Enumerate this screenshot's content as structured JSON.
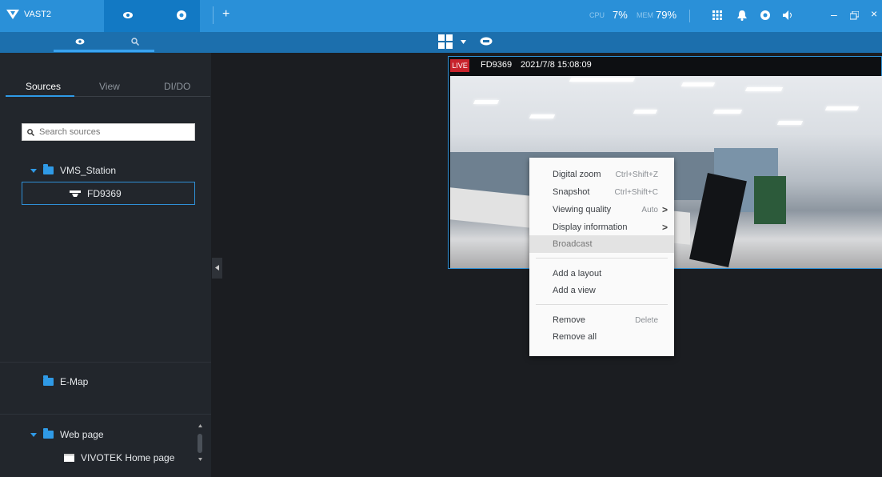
{
  "app": {
    "name": "VAST2"
  },
  "titlebar": {
    "add_tab": "+",
    "cpu_label": "CPU",
    "cpu_value": "7%",
    "mem_label": "MEM",
    "mem_value": "79%",
    "minimize": "–",
    "close": "×"
  },
  "sidebar": {
    "tabs": [
      "Sources",
      "View",
      "DI/DO"
    ],
    "search_placeholder": "Search sources",
    "tree": {
      "root": "VMS_Station",
      "camera": "FD9369"
    },
    "emap": "E-Map",
    "webpage": {
      "folder": "Web page",
      "item": "VIVOTEK Home page"
    }
  },
  "viewcell": {
    "live_badge": "LIVE",
    "camera": "FD9369",
    "timestamp": "2021/7/8 15:08:09"
  },
  "context_menu": {
    "items": [
      {
        "label": "Digital zoom",
        "shortcut": "Ctrl+Shift+Z"
      },
      {
        "label": "Snapshot",
        "shortcut": "Ctrl+Shift+C"
      },
      {
        "label": "Viewing quality",
        "shortcut": "Auto",
        "submenu": ">"
      },
      {
        "label": "Display information",
        "submenu": ">"
      },
      {
        "label": "Broadcast"
      },
      {
        "label": "Add a layout"
      },
      {
        "label": "Add a view"
      },
      {
        "label": "Remove",
        "shortcut": "Delete"
      },
      {
        "label": "Remove all"
      }
    ]
  },
  "colors": {
    "accent": "#2a90d8",
    "live": "#c8232c",
    "panel": "#22262c"
  }
}
